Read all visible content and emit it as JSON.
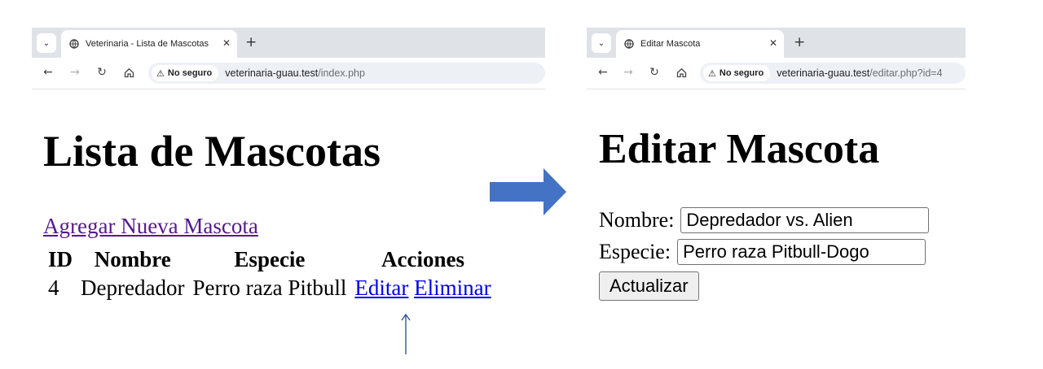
{
  "left_window": {
    "tab_title": "Veterinaria - Lista de Mascotas",
    "tab_close": "✕",
    "new_tab": "+",
    "security_chip": "No seguro",
    "url_host": "veterinaria-guau.test",
    "url_path": "/index.php",
    "page": {
      "title": "Lista de Mascotas",
      "add_link": "Agregar Nueva Mascota",
      "table": {
        "headers": [
          "ID",
          "Nombre",
          "Especie",
          "Acciones"
        ],
        "rows": [
          {
            "id": "4",
            "nombre": "Depredador",
            "especie": "Perro raza Pitbull",
            "edit_label": "Editar",
            "delete_label": "Eliminar"
          }
        ]
      }
    }
  },
  "right_window": {
    "tab_title": "Editar Mascota",
    "tab_close": "✕",
    "new_tab": "+",
    "security_chip": "No seguro",
    "url_host": "veterinaria-guau.test",
    "url_path": "/editar.php?id=4",
    "page": {
      "title": "Editar Mascota",
      "nombre_label": "Nombre:",
      "nombre_value": "Depredador vs. Alien",
      "especie_label": "Especie:",
      "especie_value": "Perro raza Pitbull-Dogo",
      "submit_label": "Actualizar"
    }
  },
  "annotations": {
    "flow_arrow_color": "#4472c4",
    "pointer_arrow_color": "#2f5597"
  },
  "icons": [
    "tab-menu-icon",
    "globe-icon",
    "close-icon",
    "plus-icon",
    "back-icon",
    "forward-icon",
    "reload-icon",
    "home-icon",
    "warning-icon"
  ]
}
